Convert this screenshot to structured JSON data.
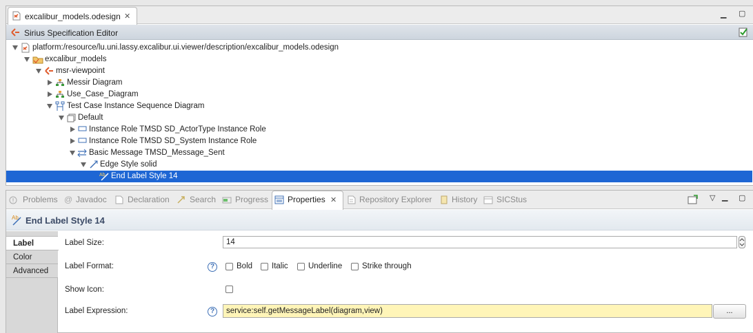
{
  "editor": {
    "tab_title": "excalibur_models.odesign",
    "header_title": "Sirius Specification Editor",
    "tree": [
      {
        "label": "platform:/resource/lu.uni.lassy.excalibur.ui.viewer/description/excalibur_models.odesign",
        "icon": "odesign-file-icon",
        "expanded": true
      },
      {
        "label": "excalibur_models",
        "icon": "folder-icon",
        "expanded": true
      },
      {
        "label": "msr-viewpoint",
        "icon": "viewpoint-icon",
        "expanded": true
      },
      {
        "label": "Messir Diagram",
        "icon": "diagram-icon",
        "expanded": false
      },
      {
        "label": "Use_Case_Diagram",
        "icon": "diagram-icon",
        "expanded": false
      },
      {
        "label": "Test Case Instance Sequence Diagram",
        "icon": "sequence-diagram-icon",
        "expanded": true
      },
      {
        "label": "Default",
        "icon": "layer-icon",
        "expanded": true
      },
      {
        "label": "Instance Role TMSD SD_ActorType Instance Role",
        "icon": "instance-role-icon",
        "expanded": false
      },
      {
        "label": "Instance Role TMSD SD_System Instance Role",
        "icon": "instance-role-icon",
        "expanded": false
      },
      {
        "label": "Basic Message TMSD_Message_Sent",
        "icon": "message-icon",
        "expanded": true
      },
      {
        "label": "Edge Style solid",
        "icon": "edge-style-icon",
        "expanded": true
      },
      {
        "label": "End Label Style 14",
        "icon": "label-style-icon",
        "selected": true
      }
    ]
  },
  "views": {
    "tabs": [
      {
        "label": "Problems",
        "icon": "problems-icon"
      },
      {
        "label": "Javadoc",
        "icon": "javadoc-icon"
      },
      {
        "label": "Declaration",
        "icon": "declaration-icon"
      },
      {
        "label": "Search",
        "icon": "search-icon"
      },
      {
        "label": "Progress",
        "icon": "progress-icon"
      },
      {
        "label": "Properties",
        "icon": "properties-icon",
        "active": true
      },
      {
        "label": "Repository Explorer",
        "icon": "repository-icon"
      },
      {
        "label": "History",
        "icon": "history-icon"
      },
      {
        "label": "SICStus",
        "icon": "sicstus-icon"
      }
    ]
  },
  "properties": {
    "title": "End Label Style 14",
    "side_tabs": [
      "Label",
      "Color",
      "Advanced"
    ],
    "label_size_label": "Label Size:",
    "label_size_value": "14",
    "label_format_label": "Label Format:",
    "format_options": [
      "Bold",
      "Italic",
      "Underline",
      "Strike through"
    ],
    "show_icon_label": "Show Icon:",
    "label_expression_label": "Label Expression:",
    "label_expression_value": "service:self.getMessageLabel(diagram,view)",
    "browse_button": "...",
    "help_glyph": "?"
  },
  "colors": {
    "selection": "#1e66d4",
    "expression_bg": "#fff5b8",
    "title_text": "#3b4a66"
  }
}
